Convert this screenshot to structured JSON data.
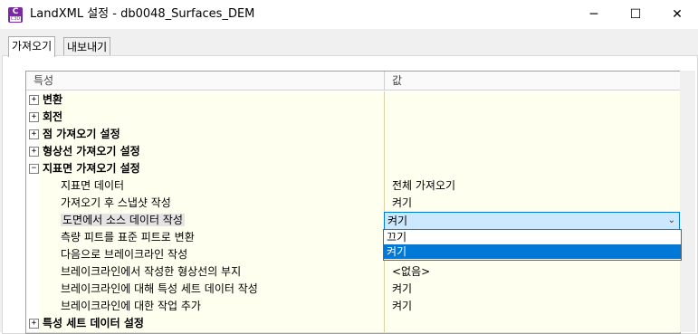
{
  "window": {
    "title": "LandXML 설정 - db0048_Surfaces_DEM",
    "icon_letter": "C",
    "icon_sub": "C3D",
    "minimize_glyph": "─",
    "maximize_glyph": "☐",
    "close_glyph": "✕"
  },
  "tabs": [
    {
      "label": "가져오기",
      "active": true
    },
    {
      "label": "내보내기",
      "active": false
    }
  ],
  "grid": {
    "header_name": "특성",
    "header_value": "값",
    "rows": [
      {
        "type": "category",
        "expander": "+",
        "name": "변환",
        "value": ""
      },
      {
        "type": "category",
        "expander": "+",
        "name": "회전",
        "value": ""
      },
      {
        "type": "category",
        "expander": "+",
        "name": "점 가져오기 설정",
        "value": ""
      },
      {
        "type": "category",
        "expander": "+",
        "name": "형상선 가져오기 설정",
        "value": ""
      },
      {
        "type": "category",
        "expander": "−",
        "name": "지표면 가져오기 설정",
        "value": ""
      },
      {
        "type": "property",
        "name": "지표면 데이터",
        "value": "전체 가져오기"
      },
      {
        "type": "property",
        "name": "가져오기 후 스냅샷 작성",
        "value": "켜기"
      },
      {
        "type": "property",
        "name": "도면에서 소스 데이터 작성",
        "value": "켜기",
        "selected": true
      },
      {
        "type": "property",
        "name": "측량 피트를 표준 피트로 변환",
        "value": ""
      },
      {
        "type": "property",
        "name": "다음으로 브레이크라인 작성",
        "value": ""
      },
      {
        "type": "property",
        "name": "브레이크라인에서 작성한 형상선의 부지",
        "value": "<없음>"
      },
      {
        "type": "property",
        "name": "브레이크라인에 대해 특성 세트 데이터 작성",
        "value": "켜기"
      },
      {
        "type": "property",
        "name": "브레이크라인에 대한 작업 추가",
        "value": "켜기"
      },
      {
        "type": "category",
        "expander": "+",
        "name": "특성 세트 데이터 설정",
        "value": ""
      }
    ]
  },
  "dropdown": {
    "current": "켜기",
    "chevron": "⌄",
    "options": [
      {
        "label": "끄기",
        "highlighted": false
      },
      {
        "label": "켜기",
        "highlighted": true
      }
    ]
  }
}
